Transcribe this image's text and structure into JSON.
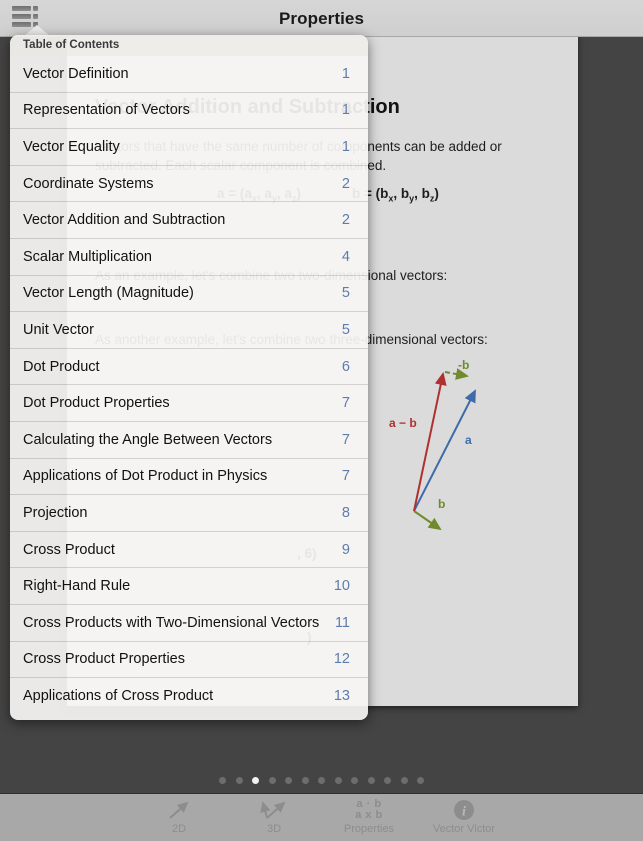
{
  "navbar": {
    "title": "Properties",
    "menu_icon": "list-icon"
  },
  "popover": {
    "header": "Table of Contents",
    "items": [
      {
        "title": "Vector Definition",
        "page": "1"
      },
      {
        "title": "Representation of Vectors",
        "page": "1"
      },
      {
        "title": "Vector Equality",
        "page": "1"
      },
      {
        "title": "Coordinate Systems",
        "page": "2"
      },
      {
        "title": "Vector Addition and Subtraction",
        "page": "2"
      },
      {
        "title": "Scalar Multiplication",
        "page": "4"
      },
      {
        "title": "Vector Length (Magnitude)",
        "page": "5"
      },
      {
        "title": "Unit Vector",
        "page": "5"
      },
      {
        "title": "Dot Product",
        "page": "6"
      },
      {
        "title": "Dot Product Properties",
        "page": "7"
      },
      {
        "title": "Calculating the Angle Between Vectors",
        "page": "7"
      },
      {
        "title": "Applications of Dot Product in Physics",
        "page": "7"
      },
      {
        "title": "Projection",
        "page": "8"
      },
      {
        "title": "Cross Product",
        "page": "9"
      },
      {
        "title": "Right-Hand Rule",
        "page": "10"
      },
      {
        "title": "Cross Products with Two-Dimensional Vectors",
        "page": "11"
      },
      {
        "title": "Cross Product Properties",
        "page": "12"
      },
      {
        "title": "Applications of Cross Product",
        "page": "13"
      }
    ]
  },
  "document": {
    "heading": "Vector Addition and Subtraction",
    "paragraph1_line1": "Vectors that have the same number of components can be added or",
    "paragraph1_line2": "subtracted. Each scalar component is combined.",
    "equation_a": "a = (a",
    "equation_b": "b = (b",
    "line_example_2d": "As an example, let's combine two two-dimensional vectors:",
    "line_example_3d": "As another example, let's combine two three-dimensional vectors:",
    "value_6": ", 6)",
    "figure": {
      "label_a": "a",
      "label_b": "b",
      "label_neg_b": "-b",
      "label_a_minus_b": "a − b",
      "color_a": "#3f6bab",
      "color_b": "#6f8b2e",
      "color_a_minus_b": "#b03030"
    }
  },
  "page_dots": {
    "count": 13,
    "active_index": 2
  },
  "tabbar": {
    "tabs": [
      {
        "label": "2D",
        "icon": "arrow-2d-icon"
      },
      {
        "label": "3D",
        "icon": "arrow-3d-icon"
      },
      {
        "label": "Properties",
        "icon": "dot-cross-product-icon",
        "line1": "a · b",
        "line2": "a x b"
      },
      {
        "label": "Vector Victor",
        "icon": "info-icon"
      }
    ],
    "selected": "Properties"
  },
  "colors": {
    "background": "#444444",
    "navbar": "#d2d2d2",
    "page": "#dbdbdb",
    "popover": "#f6f5f3",
    "page_number": "#5d7cae",
    "tabbar": "#a8a8a8"
  }
}
